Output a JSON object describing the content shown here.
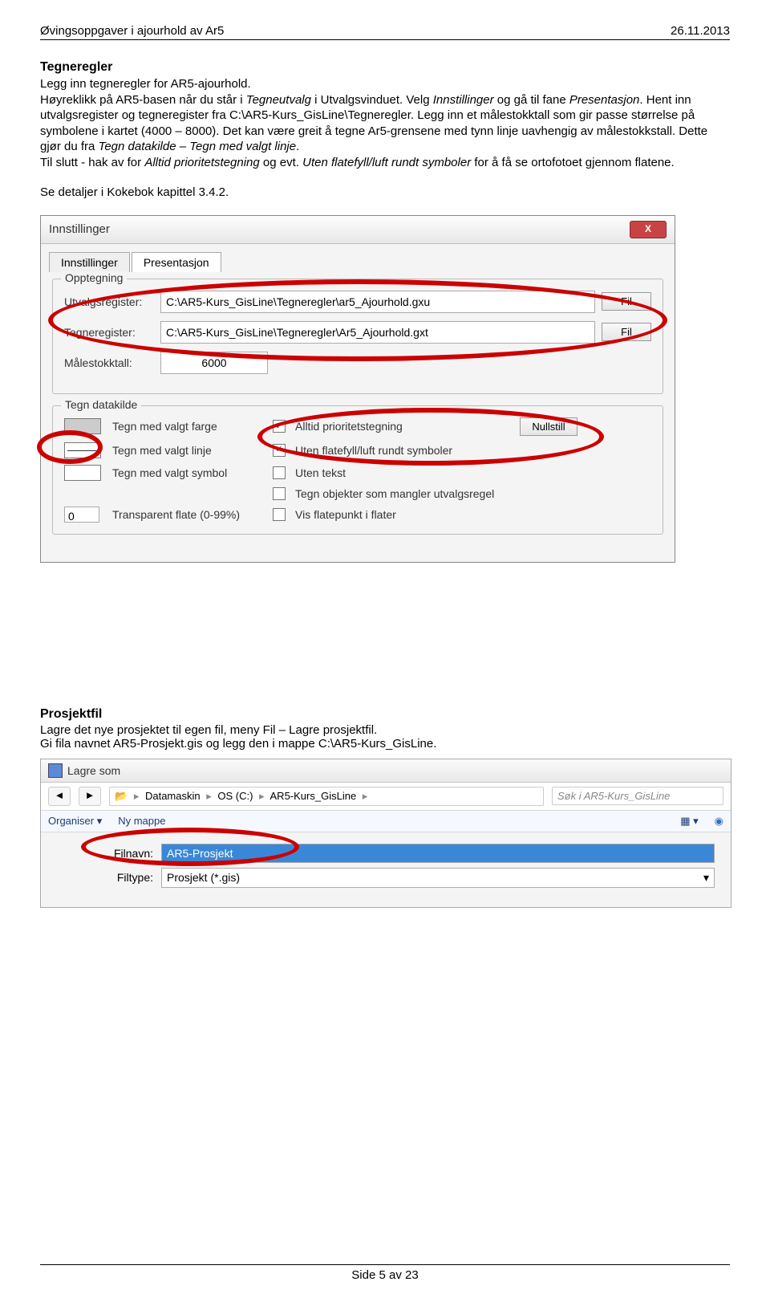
{
  "header": {
    "left": "Øvingsoppgaver i ajourhold av Ar5",
    "right": "26.11.2013"
  },
  "section1": {
    "title": "Tegneregler",
    "p1a": "Legg inn tegneregler for AR5-ajourhold.",
    "p1b_1": "Høyreklikk på AR5-basen når du står i ",
    "p1b_i1": "Tegneutvalg",
    "p1b_2": " i Utvalgsvinduet. Velg ",
    "p1b_i2": "Innstillinger",
    "p1b_3": " og gå til fane ",
    "p1b_i3": "Presentasjon",
    "p1b_4": ". Hent inn utvalgsregister og tegneregister fra C:\\AR5-Kurs_GisLine\\Tegneregler. Legg inn et målestokktall som gir passe størrelse på symbolene i kartet (4000 – 8000). Det kan være greit å tegne Ar5-grensene med tynn linje uavhengig av målestokkstall. Dette gjør du fra ",
    "p1b_i4": "Tegn datakilde",
    "p1b_5": " – ",
    "p1b_i5": "Tegn med valgt linje",
    "p1b_6": ".",
    "p2_1": "Til slutt - hak av for ",
    "p2_i1": "Alltid prioritetstegning",
    "p2_2": " og evt. ",
    "p2_i2": "Uten flatefyll/luft rundt symboler",
    "p2_3": " for å få se ortofotoet gjennom flatene.",
    "p3": "Se detaljer i Kokebok kapittel 3.4.2."
  },
  "dialog": {
    "title": "Innstillinger",
    "tab1": "Innstillinger",
    "tab2": "Presentasjon",
    "group1": "Opptegning",
    "lbl_utv": "Utvalgsregister:",
    "val_utv": "C:\\AR5-Kurs_GisLine\\Tegneregler\\ar5_Ajourhold.gxu",
    "lbl_teg": "Tegneregister:",
    "val_teg": "C:\\AR5-Kurs_GisLine\\Tegneregler\\Ar5_Ajourhold.gxt",
    "btn_fil": "Fil",
    "lbl_mal": "Målestokktall:",
    "val_mal": "6000",
    "group2": "Tegn datakilde",
    "r1": "Tegn med valgt farge",
    "r2": "Tegn med valgt linje",
    "r3": "Tegn med valgt symbol",
    "r4": "Transparent flate (0-99%)",
    "r4_val": "0",
    "c1": "Alltid prioritetstegning",
    "c2": "Uten flatefyll/luft rundt symboler",
    "c3": "Uten tekst",
    "c4": "Tegn objekter som mangler utvalgsregel",
    "c5": "Vis flatepunkt i flater",
    "btn_null": "Nullstill"
  },
  "section2": {
    "title": "Prosjektfil",
    "line1": "Lagre det nye prosjektet til egen fil, meny Fil – Lagre prosjektfil.",
    "line2": "Gi fila navnet AR5-Prosjekt.gis og legg den i mappe C:\\AR5-Kurs_GisLine."
  },
  "lagre": {
    "title": "Lagre som",
    "crumb1": "Datamaskin",
    "crumb2": "OS (C:)",
    "crumb3": "AR5-Kurs_GisLine",
    "search_ph": "Søk i AR5-Kurs_GisLine",
    "tool1": "Organiser ▾",
    "tool2": "Ny mappe",
    "lbl_fn": "Filnavn:",
    "val_fn": "AR5-Prosjekt",
    "lbl_ft": "Filtype:",
    "val_ft": "Prosjekt (*.gis)"
  },
  "footer": "Side 5 av 23"
}
